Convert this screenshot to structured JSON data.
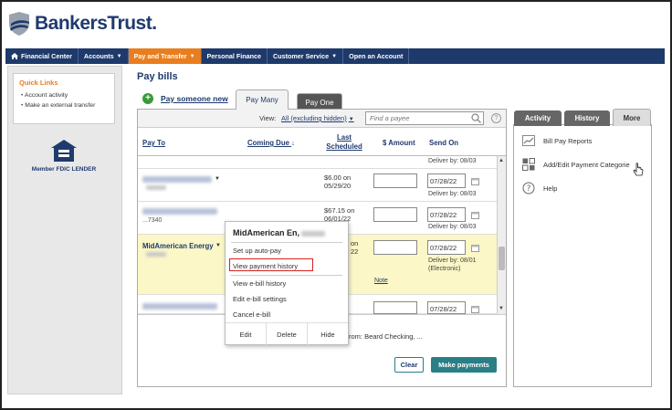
{
  "brand": {
    "name": "BankersTrust",
    "dot": "."
  },
  "nav": [
    {
      "label": "Financial Center",
      "icon": "home-icon",
      "caret": false,
      "active": false
    },
    {
      "label": "Accounts",
      "caret": true,
      "active": false
    },
    {
      "label": "Pay and Transfer",
      "caret": true,
      "active": true
    },
    {
      "label": "Personal Finance",
      "caret": false,
      "active": false
    },
    {
      "label": "Customer Service",
      "caret": true,
      "active": false
    },
    {
      "label": "Open an Account",
      "caret": false,
      "active": false
    }
  ],
  "sidebar": {
    "quick_links_title": "Quick Links",
    "items": [
      "Account activity",
      "Make an external transfer"
    ],
    "fdic_label": "Member FDIC LENDER"
  },
  "main": {
    "title": "Pay bills",
    "pay_new": "Pay someone new",
    "tabs": {
      "many": "Pay Many",
      "one": "Pay One"
    },
    "view_label": "View:",
    "view_value": "All (excluding hidden)",
    "search_placeholder": "Find a payee",
    "columns": {
      "pay_to": "Pay To",
      "coming_due": "Coming Due",
      "last_line1": "Last",
      "last_line2": "Scheduled",
      "amount": "$ Amount",
      "send_on": "Send On"
    },
    "rows": [
      {
        "deliver": "Deliver by: 08/03"
      },
      {
        "last1": "$6.00 on",
        "last2": "05/29/20",
        "date": "07/28/22",
        "deliver": "Deliver by: 08/03"
      },
      {
        "last1": "$67.15 on",
        "last2": "06/01/22",
        "acct": "...7340",
        "date": "07/28/22",
        "deliver": "Deliver by: 08/03"
      },
      {
        "name": "MidAmerican Energy",
        "last1": "on",
        "last2": "22",
        "date": "07/28/22",
        "deliver1": "Deliver by: 08/01",
        "deliver2": "(Electronic)",
        "note": "Note"
      },
      {
        "date": "07/28/22"
      }
    ],
    "from_text": "rom: Beard Checking, ...",
    "clear": "Clear",
    "make_payments": "Make payments"
  },
  "popup": {
    "title": "MidAmerican En,",
    "items": [
      "Set up auto-pay",
      "View payment history",
      "View e-bill history",
      "Edit e-bill settings",
      "Cancel e-bill"
    ],
    "actions": [
      "Edit",
      "Delete",
      "Hide"
    ]
  },
  "right": {
    "tabs": [
      "Activity",
      "History",
      "More"
    ],
    "items": [
      {
        "label": "Bill Pay Reports",
        "icon": "chart-icon"
      },
      {
        "label": "Add/Edit Payment Categorie",
        "icon": "categories-icon"
      },
      {
        "label": "Help",
        "icon": "help-icon"
      }
    ]
  },
  "colors": {
    "navy": "#1e3a6a",
    "orange": "#e87e1e",
    "teal": "#2a7f86",
    "highlight_row": "#fbf7c6",
    "red_box": "#d82020"
  }
}
